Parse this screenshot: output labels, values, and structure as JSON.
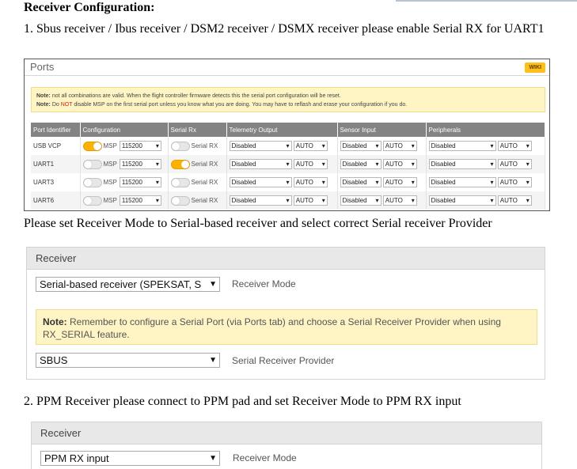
{
  "doc": {
    "heading": "Receiver Configuration:",
    "step1": "1. Sbus receiver / Ibus receiver / DSM2 receiver / DSMX receiver please enable Serial RX for UART1",
    "mid_text": "Please set Receiver Mode to Serial-based receiver and select correct Serial receiver Provider",
    "step2": "2. PPM Receiver please connect to PPM pad and set Receiver Mode to PPM RX input"
  },
  "ports": {
    "title": "Ports",
    "wiki_label": "WIKI",
    "note1_bold": "Note:",
    "note1_text": " not all combinations are valid. When the flight controller firmware detects this the serial port configuration will be reset.",
    "note2_bold": "Note:",
    "note2_pre": " Do ",
    "note2_not": "NOT",
    "note2_post": " disable MSP on the first serial port unless you know what you are doing. You may have to reflash and erase your configuration if you do.",
    "columns": [
      "Port Identifier",
      "Configuration",
      "Serial Rx",
      "Telemetry Output",
      "Sensor Input",
      "Peripherals"
    ],
    "msp_label": "MSP",
    "serial_rx_label": "Serial RX",
    "rows": [
      {
        "port": "USB VCP",
        "msp_on": true,
        "baud": "115200",
        "serial_rx_on": false,
        "telemetry": "Disabled",
        "telemetry_auto": "AUTO",
        "sensor": "Disabled",
        "sensor_auto": "AUTO",
        "peripheral": "Disabled",
        "peripheral_auto": "AUTO"
      },
      {
        "port": "UART1",
        "msp_on": false,
        "baud": "115200",
        "serial_rx_on": true,
        "telemetry": "Disabled",
        "telemetry_auto": "AUTO",
        "sensor": "Disabled",
        "sensor_auto": "AUTO",
        "peripheral": "Disabled",
        "peripheral_auto": "AUTO"
      },
      {
        "port": "UART3",
        "msp_on": false,
        "baud": "115200",
        "serial_rx_on": false,
        "telemetry": "Disabled",
        "telemetry_auto": "AUTO",
        "sensor": "Disabled",
        "sensor_auto": "AUTO",
        "peripheral": "Disabled",
        "peripheral_auto": "AUTO"
      },
      {
        "port": "UART6",
        "msp_on": false,
        "baud": "115200",
        "serial_rx_on": false,
        "telemetry": "Disabled",
        "telemetry_auto": "AUTO",
        "sensor": "Disabled",
        "sensor_auto": "AUTO",
        "peripheral": "Disabled",
        "peripheral_auto": "AUTO"
      }
    ]
  },
  "receiver1": {
    "title": "Receiver",
    "mode_value": "Serial-based receiver (SPEKSAT, S",
    "mode_label": "Receiver Mode",
    "note_bold": "Note:",
    "note_text": " Remember to configure a Serial Port (via Ports tab) and choose a Serial Receiver Provider when using RX_SERIAL feature.",
    "provider_value": "SBUS",
    "provider_label": "Serial Receiver Provider"
  },
  "receiver2": {
    "title": "Receiver",
    "mode_value": "PPM RX input",
    "mode_label": "Receiver Mode"
  },
  "colors": {
    "toggle_on": "#ffb100",
    "note_bg": "#fff4c4",
    "table_header": "#838383",
    "wiki_badge": "#ffbe1a",
    "warning_red": "#d42020"
  }
}
